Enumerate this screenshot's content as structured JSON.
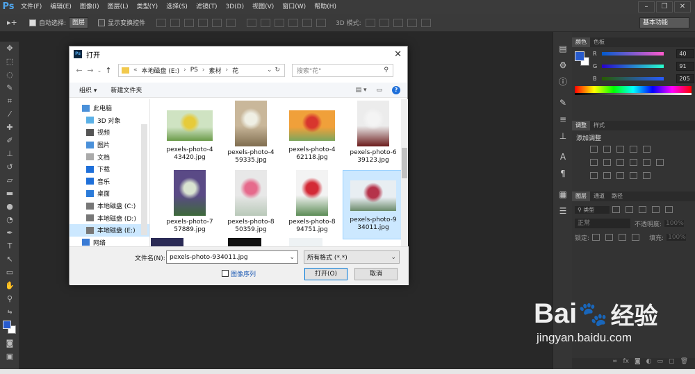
{
  "app": {
    "logo": "Ps"
  },
  "menu": [
    "文件(F)",
    "编辑(E)",
    "图像(I)",
    "图层(L)",
    "类型(Y)",
    "选择(S)",
    "滤镜(T)",
    "3D(D)",
    "视图(V)",
    "窗口(W)",
    "帮助(H)"
  ],
  "options": {
    "auto_select_label": "自动选择:",
    "auto_select_value": "图层",
    "show_transform_label": "显示变换控件",
    "mode_3d_label": "3D 模式:",
    "workspace": "基本功能"
  },
  "panels": {
    "color_tabs": [
      "颜色",
      "色板"
    ],
    "r_label": "R",
    "r_value": "40",
    "g_label": "G",
    "g_value": "91",
    "b_label": "B",
    "b_value": "205",
    "adjust_tabs": [
      "调整",
      "样式"
    ],
    "add_adjustment": "添加调整",
    "layer_tabs": [
      "图层",
      "通道",
      "路径"
    ],
    "layer_filter": "类型",
    "blend_mode": "正常",
    "opacity_label": "不透明度:",
    "opacity_value": "100%",
    "lock_label": "锁定:",
    "fill_label": "填充:",
    "fill_value": "100%"
  },
  "dialog": {
    "title": "打开",
    "breadcrumb": [
      "本地磁盘 (E:)",
      "PS",
      "素材",
      "花"
    ],
    "search_placeholder": "搜索\"花\"",
    "organize": "组织 ▾",
    "new_folder": "新建文件夹",
    "nav": [
      {
        "label": "此电脑",
        "icon": "computer-icon",
        "sub": false
      },
      {
        "label": "3D 对象",
        "icon": "3d-objects-icon",
        "sub": true
      },
      {
        "label": "视频",
        "icon": "video-icon",
        "sub": true
      },
      {
        "label": "图片",
        "icon": "pictures-icon",
        "sub": true
      },
      {
        "label": "文档",
        "icon": "documents-icon",
        "sub": true
      },
      {
        "label": "下载",
        "icon": "download-icon",
        "sub": true
      },
      {
        "label": "音乐",
        "icon": "music-icon",
        "sub": true
      },
      {
        "label": "桌面",
        "icon": "desktop-icon",
        "sub": true
      },
      {
        "label": "本地磁盘 (C:)",
        "icon": "drive-icon",
        "sub": true
      },
      {
        "label": "本地磁盘 (D:)",
        "icon": "drive-icon",
        "sub": true
      },
      {
        "label": "本地磁盘 (E:)",
        "icon": "drive-icon",
        "sub": true,
        "selected": true
      },
      {
        "label": "网络",
        "icon": "network-icon",
        "sub": false
      }
    ],
    "files": [
      {
        "name1": "pexels-photo-4",
        "name2": "43420.jpg",
        "colors": [
          "#cfe3c2",
          "#e6cb3a",
          "#6c9b4a"
        ]
      },
      {
        "name1": "pexels-photo-4",
        "name2": "59335.jpg",
        "colors": [
          "#c9b79a",
          "#efefe4",
          "#7f6d4f"
        ]
      },
      {
        "name1": "pexels-photo-4",
        "name2": "62118.jpg",
        "colors": [
          "#f0a03a",
          "#d8362e",
          "#7ca65d"
        ]
      },
      {
        "name1": "pexels-photo-6",
        "name2": "39123.jpg",
        "colors": [
          "#ececec",
          "#f4f4f4",
          "#6b1b1b"
        ]
      },
      {
        "name1": "pexels-photo-7",
        "name2": "57889.jpg",
        "colors": [
          "#5a4a86",
          "#d9e3d0",
          "#3e6a3a"
        ]
      },
      {
        "name1": "pexels-photo-8",
        "name2": "50359.jpg",
        "colors": [
          "#e8e8e8",
          "#e66a8c",
          "#b9c9b9"
        ]
      },
      {
        "name1": "pexels-photo-8",
        "name2": "94751.jpg",
        "colors": [
          "#f3f3f3",
          "#d32a36",
          "#5d8d57"
        ]
      },
      {
        "name1": "pexels-photo-9",
        "name2": "34011.jpg",
        "colors": [
          "#e8eef2",
          "#b5334a",
          "#6b8b6b"
        ],
        "selected": true
      }
    ],
    "filename_label": "文件名(N):",
    "filename_value": "pexels-photo-934011.jpg",
    "filetype": "所有格式 (*.*)",
    "image_sequence": "图像序列",
    "open_btn": "打开(O)",
    "cancel_btn": "取消"
  },
  "watermark": {
    "brand": "Bai",
    "brand2": "经验",
    "url": "jingyan.baidu.com"
  }
}
